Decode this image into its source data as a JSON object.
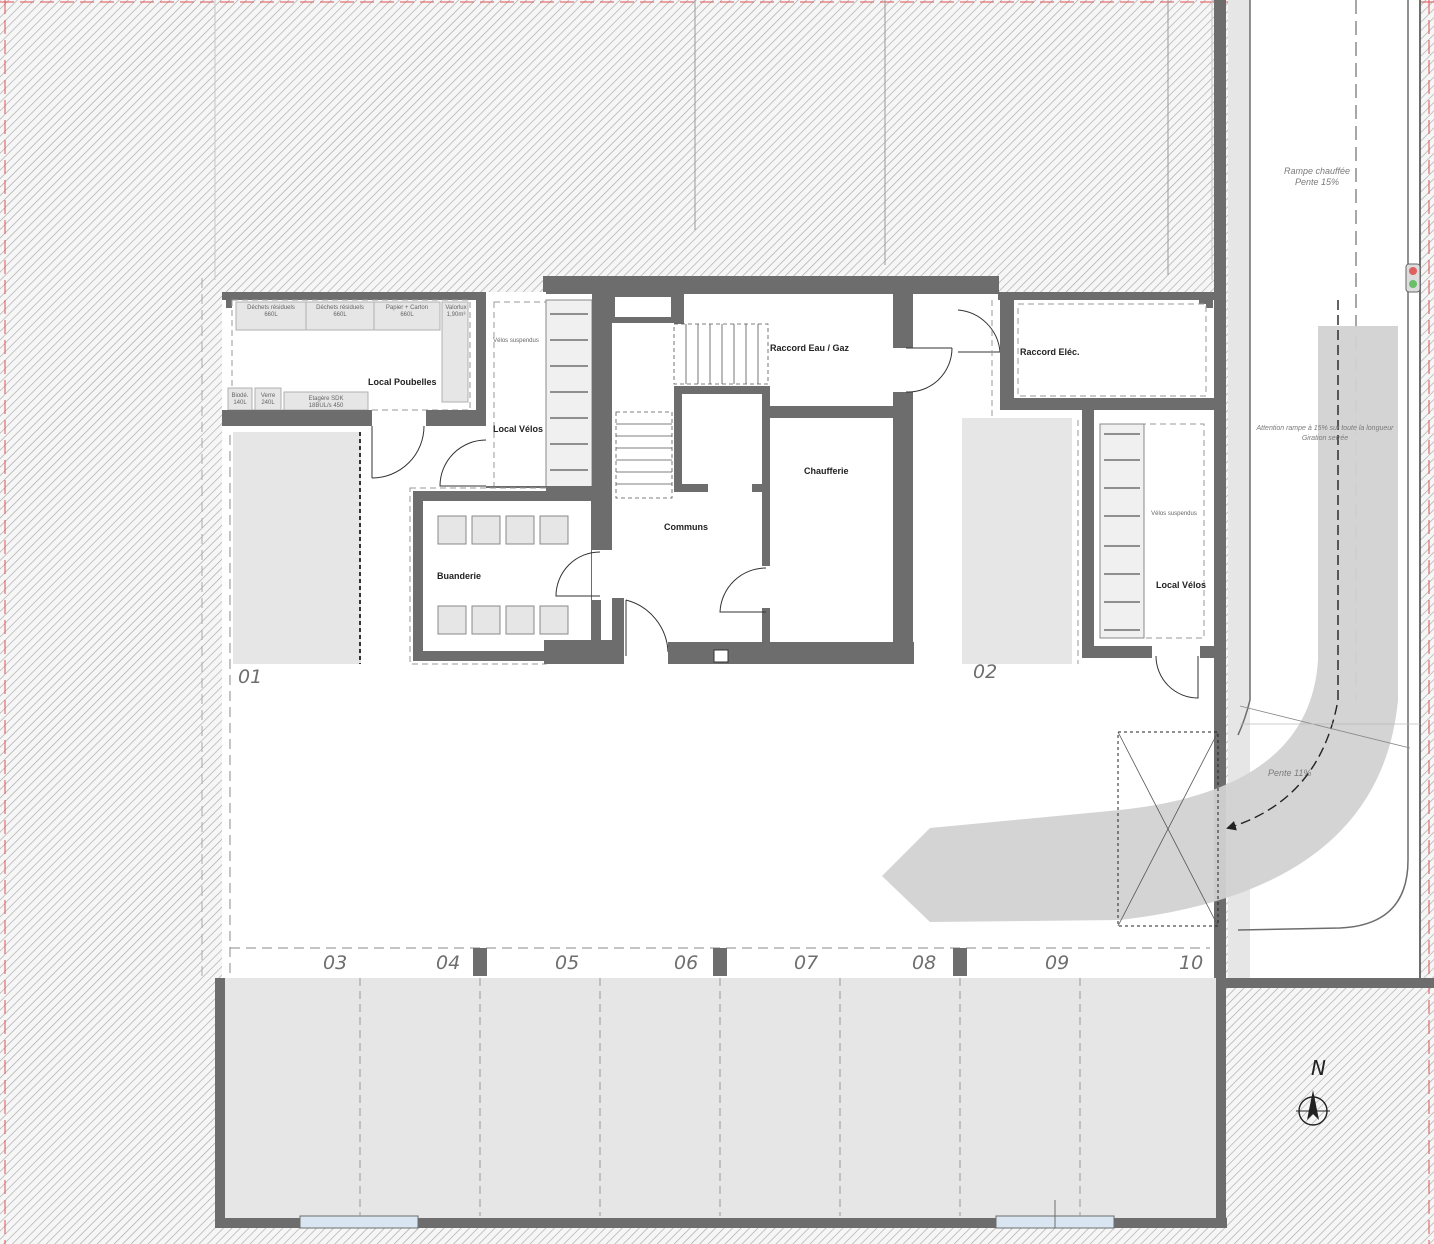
{
  "rooms": {
    "local_poubelles": "Local Poubelles",
    "local_velos_1": "Local Vélos",
    "local_velos_2": "Local Vélos",
    "raccord_eau_gaz": "Raccord Eau / Gaz",
    "raccord_elec": "Raccord Eléc.",
    "chaufferie": "Chaufferie",
    "communs": "Communs",
    "buanderie": "Buanderie"
  },
  "bins": {
    "dechets_1": "Déchets résiduels",
    "dechets_1_cap": "660L",
    "dechets_2": "Déchets résiduels",
    "dechets_2_cap": "660L",
    "papier": "Papier + Carton",
    "papier_cap": "660L",
    "valorlux": "Valorlux",
    "valorlux_cap": "1,90m³",
    "biodech": "Biodé.",
    "biodech_cap": "140L",
    "verre": "Verre",
    "verre_cap": "240L",
    "etagere": "Etagère SDK",
    "etagere_cap": "18BUL/s 450"
  },
  "velos_suspendus_1": "Vélos suspendus",
  "velos_suspendus_2": "Vélos suspendus",
  "ramp": {
    "title": "Rampe chauffée",
    "slope": "Pente 15%",
    "warning_1": "Attention rampe à 15% sur toute la longueur",
    "warning_2": "Giration serrée",
    "slope_2": "Pente 11%"
  },
  "parking_numbers": [
    "01",
    "02",
    "03",
    "04",
    "05",
    "06",
    "07",
    "08",
    "09",
    "10"
  ],
  "north": "N",
  "colors": {
    "wall": "#6d6d6d",
    "hatch": "#a8a8a8",
    "light_fill": "#e6e6e6",
    "ramp_fill": "#d2d2d2",
    "window": "#d9e6f2",
    "border_accent": "#e05050"
  }
}
